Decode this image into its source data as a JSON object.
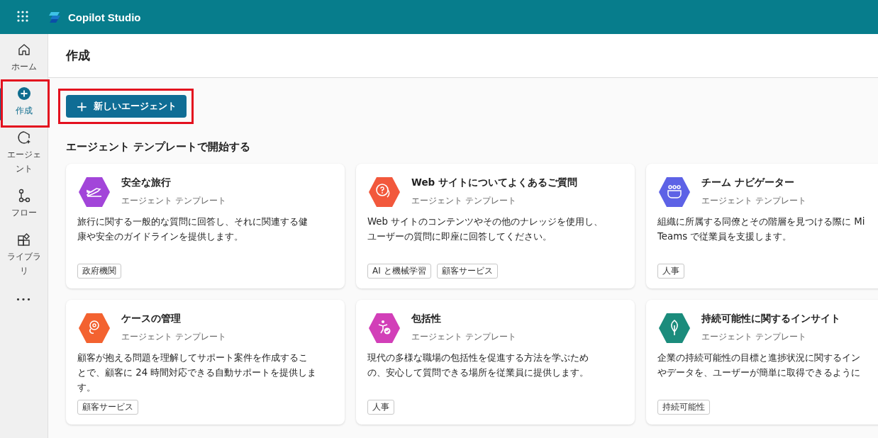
{
  "app": {
    "title": "Copilot Studio"
  },
  "nav": {
    "items": [
      {
        "label": "ホーム",
        "selected": false,
        "annotated": false
      },
      {
        "label": "作成",
        "selected": true,
        "annotated": true
      },
      {
        "label": "エージェント",
        "selected": false,
        "annotated": false
      },
      {
        "label": "フロー",
        "selected": false,
        "annotated": false
      },
      {
        "label": "ライブラリ",
        "selected": false,
        "annotated": false
      }
    ],
    "more": "•••"
  },
  "page": {
    "title": "作成",
    "new_button": {
      "icon": "+",
      "label": "新しいエージェント",
      "annotated": true
    },
    "section_title": "エージェント テンプレートで開始する"
  },
  "templates": [
    {
      "title": "安全な旅行",
      "subtitle": "エージェント テンプレート",
      "description_lines": [
        "旅行に関する一般的な質問に回答し、それに関連する健",
        "康や安全のガイドラインを提供します。"
      ],
      "tags": [
        "政府機関"
      ],
      "color": "#a245d9"
    },
    {
      "title": "Web サイトについてよくあるご質問",
      "subtitle": "エージェント テンプレート",
      "description_lines": [
        "Web サイトのコンテンツやその他のナレッジを使用し、",
        "ユーザーの質問に即座に回答してください。"
      ],
      "tags": [
        "AI と機械学習",
        "顧客サービス"
      ],
      "color": "#f2583c"
    },
    {
      "title": "チーム ナビゲーター",
      "subtitle": "エージェント テンプレート",
      "description_lines": [
        "組織に所属する同僚とその階層を見つける際に Mi",
        "Teams で従業員を支援します。"
      ],
      "tags": [
        "人事"
      ],
      "color": "#5d62e6"
    },
    {
      "title": "ケースの管理",
      "subtitle": "エージェント テンプレート",
      "description_lines": [
        "顧客が抱える問題を理解してサポート案件を作成するこ",
        "とで、顧客に 24 時間対応できる自動サポートを提供しま",
        "す。"
      ],
      "tags": [
        "顧客サービス"
      ],
      "color": "#f36230"
    },
    {
      "title": "包括性",
      "subtitle": "エージェント テンプレート",
      "description_lines": [
        "現代の多様な職場の包括性を促進する方法を学ぶため",
        "の、安心して質問できる場所を従業員に提供します。"
      ],
      "tags": [
        "人事"
      ],
      "color": "#d23fb8"
    },
    {
      "title": "持続可能性に関するインサイト",
      "subtitle": "エージェント テンプレート",
      "description_lines": [
        "企業の持続可能性の目標と進捗状況に関するイン",
        "やデータを、ユーザーが簡単に取得できるように"
      ],
      "tags": [
        "持続可能性"
      ],
      "color": "#1b8c7c"
    }
  ]
}
